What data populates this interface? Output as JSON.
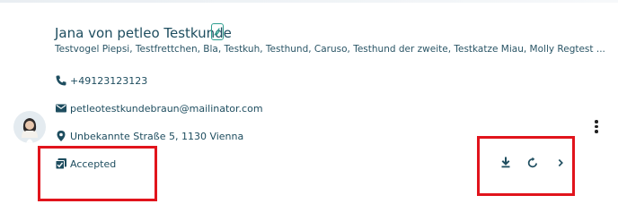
{
  "customer": {
    "name": "Jana von petleo Testkunde",
    "pets": "Testvogel Piepsi, Testfrettchen, Bla, Testkuh, Testhund, Caruso, Testhund der zweite, Testkatze Miau, Molly Regtest ...",
    "phone": "+49123123123",
    "email": "petleotestkundebraun@mailinator.com",
    "address": "Unbekannte Straße 5, 1130 Vienna",
    "status": "Accepted"
  },
  "icons": {
    "app_badge": "mobile-app-icon",
    "phone": "phone-icon",
    "email": "envelope-icon",
    "address": "location-pin-icon",
    "status": "accepted-check-icon",
    "download": "download-icon",
    "refresh": "refresh-icon",
    "next": "chevron-right-icon",
    "menu": "more-vertical-icon"
  },
  "colors": {
    "text_primary": "#1e4d5f",
    "accent": "#2f9e8f",
    "highlight_box": "#e1141c"
  }
}
